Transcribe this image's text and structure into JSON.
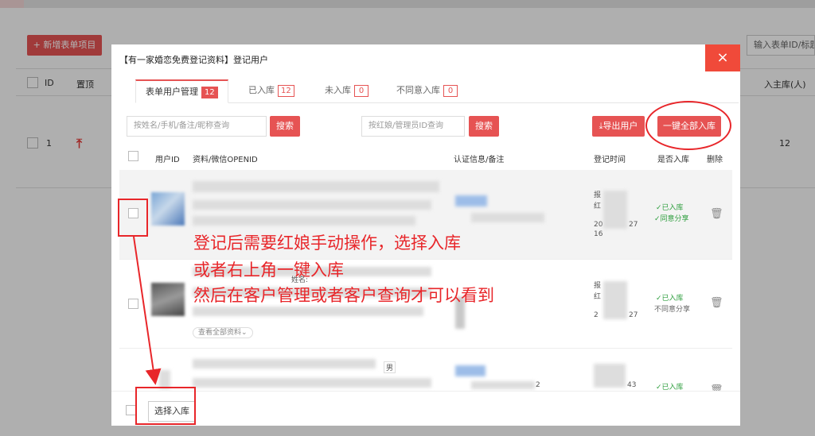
{
  "background": {
    "add_button": "+ 新增表单项目",
    "search_placeholder": "输入表单ID/标题",
    "col_id": "ID",
    "col_pin": "置顶",
    "col_right": "入主库(人)",
    "row_id": "1",
    "row_value": "12"
  },
  "modal": {
    "title": "【有一家婚恋免费登记资料】登记用户",
    "close_icon": "×",
    "tabs": [
      {
        "label": "表单用户管理",
        "count": "12"
      },
      {
        "label": "已入库",
        "count": "12"
      },
      {
        "label": "未入库",
        "count": "0"
      },
      {
        "label": "不同意入库",
        "count": "0"
      }
    ],
    "search1_placeholder": "按姓名/手机/备注/昵称查询",
    "search_button": "搜索",
    "search2_placeholder": "按红娘/管理员ID查询",
    "export_button": "导出用户",
    "one_click_button": "一键全部入库",
    "columns": {
      "user_id": "用户ID",
      "profile": "资料/微信OPENID",
      "auth": "认证信息/备注",
      "time": "登记时间",
      "in_lib": "是否入库",
      "delete": "删除"
    },
    "rows": [
      {
        "status": "已入库",
        "share": "同意分享",
        "time_a": "报",
        "time_b": "红",
        "time_c": "20",
        "time_d": "16",
        "time_suffix": "27"
      },
      {
        "status": "已入库",
        "share": "不同意分享",
        "name_label": "姓名:",
        "see_all": "查看全部资料",
        "time_a": "报",
        "time_b": "红",
        "time_c": "2",
        "time_suffix": "27"
      },
      {
        "status": "已入库",
        "gender": "男",
        "time_suffix": "43",
        "extra": "2"
      }
    ],
    "footer_button": "选择入库"
  },
  "annotation": {
    "line1": "登记后需要红娘手动操作，选择入库",
    "line2": "或者右上角一键入库",
    "line3": "然后在客户管理或者客户查询才可以看到"
  }
}
